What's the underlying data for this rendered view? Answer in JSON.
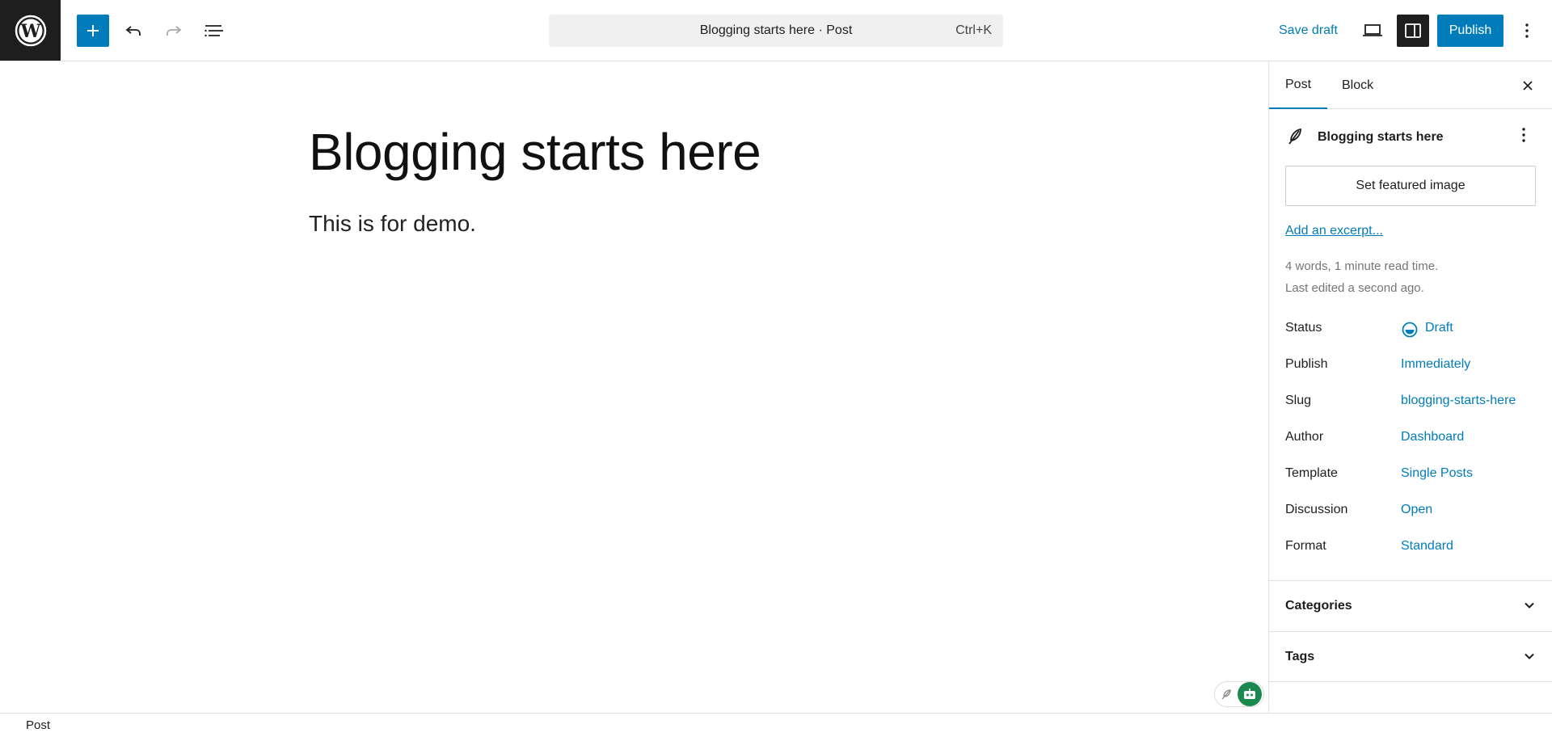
{
  "toolbar": {
    "add_block_label": "Add block",
    "command_title": "Blogging starts here · Post",
    "command_shortcut": "Ctrl+K",
    "save_draft": "Save draft",
    "publish": "Publish"
  },
  "editor": {
    "title": "Blogging starts here",
    "paragraph": "This is for demo."
  },
  "sidebar": {
    "tabs": [
      "Post",
      "Block"
    ],
    "post_title": "Blogging starts here",
    "featured_image": "Set featured image",
    "excerpt_link": "Add an excerpt...",
    "meta": [
      "4 words, 1 minute read time.",
      "Last edited a second ago."
    ],
    "fields": [
      {
        "label": "Status",
        "value": "Draft"
      },
      {
        "label": "Publish",
        "value": "Immediately"
      },
      {
        "label": "Slug",
        "value": "blogging-starts-here"
      },
      {
        "label": "Author",
        "value": "Dashboard"
      },
      {
        "label": "Template",
        "value": "Single Posts"
      },
      {
        "label": "Discussion",
        "value": "Open"
      },
      {
        "label": "Format",
        "value": "Standard"
      }
    ],
    "panels": [
      "Categories",
      "Tags"
    ]
  },
  "footer": {
    "breadcrumb": "Post"
  },
  "colors": {
    "accent": "#007cba",
    "dark": "#1e1e1e",
    "muted": "#757575",
    "bot_green": "#1a8a4f"
  }
}
